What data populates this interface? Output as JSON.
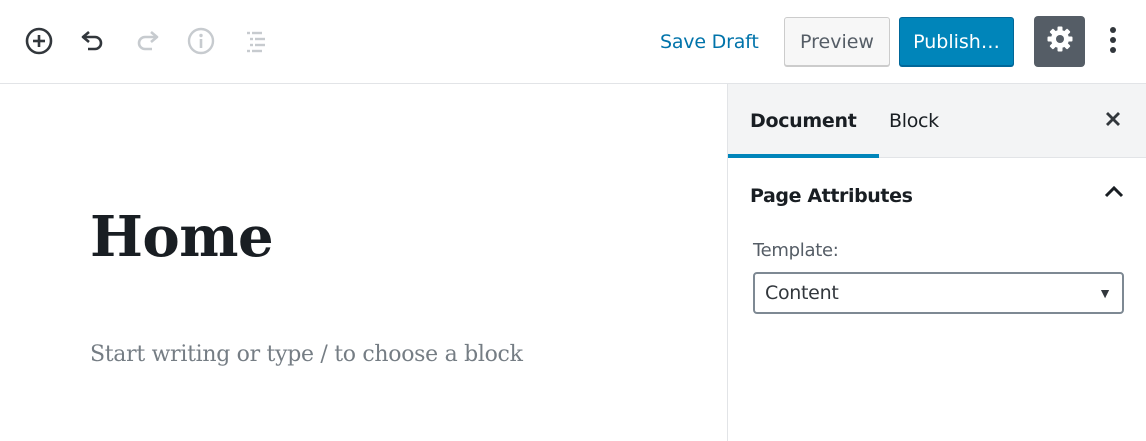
{
  "toolbar": {
    "icons": [
      "add-block-icon",
      "undo-icon",
      "redo-icon",
      "info-icon",
      "outline-icon"
    ],
    "save_draft_label": "Save Draft",
    "preview_label": "Preview",
    "publish_label": "Publish…",
    "settings_icon": "gear-icon",
    "more_icon": "more-vertical-icon"
  },
  "editor": {
    "title": "Home",
    "placeholder": "Start writing or type / to choose a block"
  },
  "sidebar": {
    "tabs": [
      {
        "label": "Document",
        "active": true
      },
      {
        "label": "Block",
        "active": false
      }
    ],
    "panel": {
      "title": "Page Attributes",
      "expanded": true,
      "template_label": "Template:",
      "template_value": "Content"
    }
  },
  "colors": {
    "accent": "#0085ba",
    "link": "#0073aa",
    "settings_bg": "#555d66"
  }
}
